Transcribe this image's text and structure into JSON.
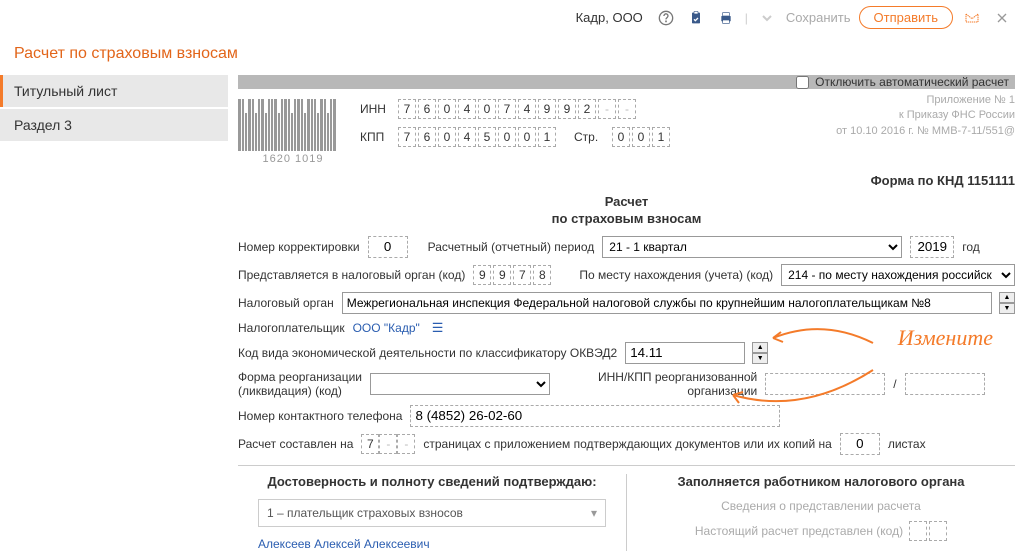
{
  "topbar": {
    "org": "Кадр, ООО",
    "save": "Сохранить",
    "send": "Отправить"
  },
  "title": "Расчет по страховым взносам",
  "sidebar": {
    "items": [
      {
        "label": "Титульный лист"
      },
      {
        "label": "Раздел 3"
      }
    ]
  },
  "topstrip": {
    "disable_auto": "Отключить автоматический расчет"
  },
  "barcode_num": "1620 1019",
  "inn": {
    "label": "ИНН",
    "cells": [
      "7",
      "6",
      "0",
      "4",
      "0",
      "7",
      "4",
      "9",
      "9",
      "2",
      "-",
      "-"
    ]
  },
  "kpp": {
    "label": "КПП",
    "cells": [
      "7",
      "6",
      "0",
      "4",
      "5",
      "0",
      "0",
      "1"
    ]
  },
  "page": {
    "label": "Стр.",
    "cells": [
      "0",
      "0",
      "1"
    ]
  },
  "appendix": {
    "l1": "Приложение № 1",
    "l2": "к Приказу ФНС России",
    "l3": "от 10.10 2016 г. № ММВ-7-11/551@"
  },
  "form_knd": "Форма по КНД 1151111",
  "center": {
    "l1": "Расчет",
    "l2": "по страховым взносам"
  },
  "fields": {
    "corr_label": "Номер корректировки",
    "corr_value": "0",
    "period_label": "Расчетный (отчетный) период",
    "period_value": "21 - 1 квартал",
    "year_value": "2019",
    "year_suffix": "год",
    "submit_to_label": "Представляется в налоговый орган (код)",
    "submit_to_cells": [
      "9",
      "9",
      "7",
      "8"
    ],
    "location_label": "По месту нахождения (учета) (код)",
    "location_value": "214 - по месту нахождения российск",
    "tax_org_label": "Налоговый орган",
    "tax_org_value": "Межрегиональная инспекция Федеральной налоговой службы по крупнейшим налогоплательщикам №8",
    "taxpayer_label": "Налогоплательщик",
    "taxpayer_value": "ООО \"Кадр\"",
    "okved_label": "Код вида экономической деятельности по классификатору ОКВЭД2",
    "okved_value": "14.11",
    "reorg_label1": "Форма реорганизации",
    "reorg_label2": "(ликвидация) (код)",
    "reorg_inn_label1": "ИНН/КПП реорганизованной",
    "reorg_inn_label2": "организации",
    "phone_label": "Номер контактного телефона",
    "phone_value": "8 (4852) 26-02-60",
    "pages_label1": "Расчет составлен на",
    "pages_cells": [
      "7",
      "-",
      "-"
    ],
    "pages_label2": "страницах с приложением подтверждающих документов или их копий на",
    "attach_value": "0",
    "attach_suffix": "листах"
  },
  "bottom": {
    "left_title": "Достоверность и полноту сведений подтверждаю:",
    "payer_type": "1 – плательщик страховых взносов",
    "person": "Алексеев Алексей Алексеевич",
    "right_title": "Заполняется работником налогового органа",
    "info1": "Сведения о представлении расчета",
    "info2": "Настоящий расчет представлен (код)"
  },
  "annotation": "Измените"
}
